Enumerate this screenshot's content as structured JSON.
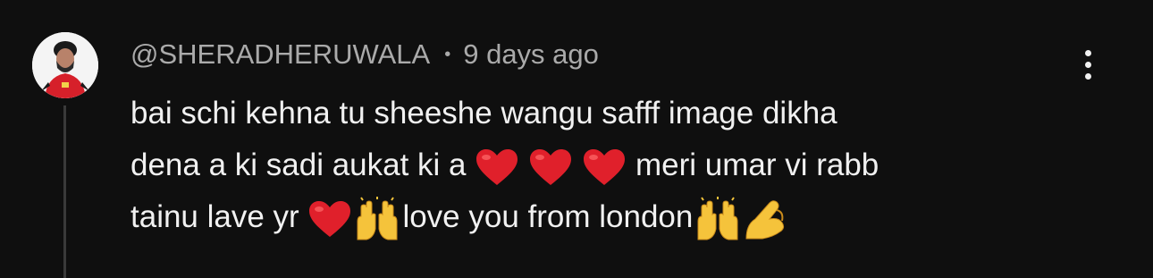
{
  "comment": {
    "author": "@SHERADHERUWALA",
    "separator": "•",
    "time": "9 days ago",
    "text_lines": [
      {
        "pre": "bai schi kehna tu sheeshe wangu safff image dikha",
        "post": ""
      },
      {
        "pre": "dena a ki sadi aukat ki a ",
        "post": " meri umar vi rabb"
      },
      {
        "pre": "tainu lave yr ",
        "mid": "love you from london",
        "post": ""
      }
    ],
    "emoji": {
      "heart": "red-heart-icon",
      "raised_hands": "raised-hands-icon",
      "pinch": "pinching-hand-icon"
    }
  },
  "colors": {
    "background": "#0f0f0f",
    "text": "#f1f1f1",
    "secondary_text": "#aaaaaa",
    "thread_line": "#3a3a3a",
    "heart": "#e0202b"
  }
}
